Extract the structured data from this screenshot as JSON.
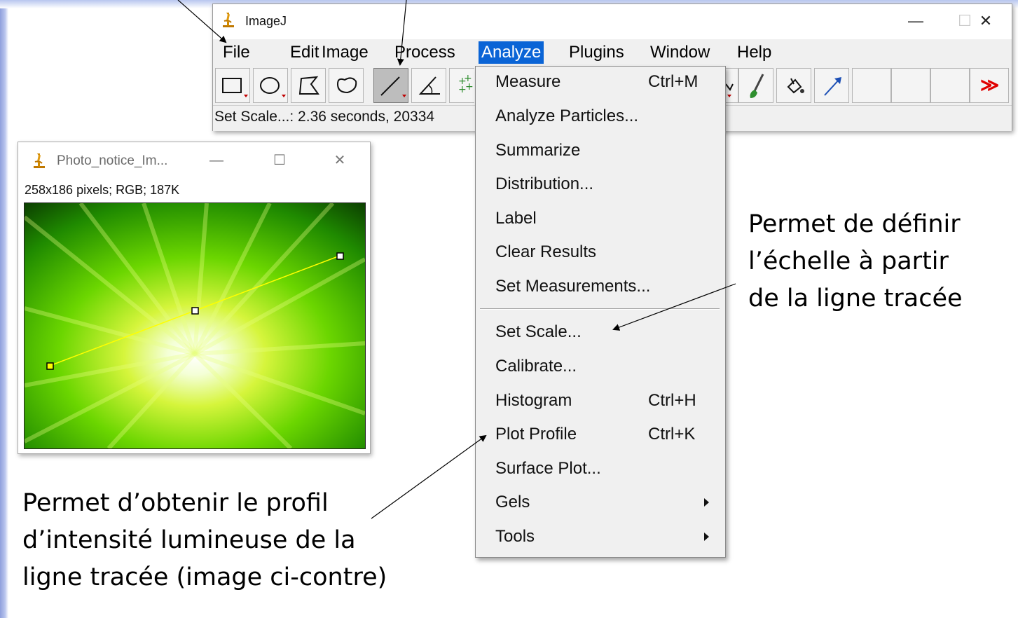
{
  "main_window": {
    "title": "ImageJ",
    "controls": {
      "minimize": "—",
      "maximize": "☐",
      "close": "✕"
    },
    "menus": [
      "File",
      "Edit",
      "Image",
      "Process",
      "Analyze",
      "Plugins",
      "Window",
      "Help"
    ],
    "active_menu": "Analyze",
    "status": "Set Scale...: 2.36 seconds, 20334",
    "tools": [
      "rectangle-icon",
      "oval-icon",
      "polygon-icon",
      "freehand-icon",
      "line-icon",
      "angle-icon",
      "point-icon",
      "dropper-icon",
      "brush-icon",
      "flood-fill-icon",
      "arrow-icon"
    ],
    "more_tools": "≫"
  },
  "image_window": {
    "title": "Photo_notice_Im...",
    "info": "258x186 pixels; RGB; 187K",
    "controls": {
      "minimize": "—",
      "maximize": "☐",
      "close": "✕"
    }
  },
  "analyze_menu": {
    "items": [
      {
        "label": "Measure",
        "shortcut": "Ctrl+M",
        "submenu": false
      },
      {
        "label": "Analyze Particles...",
        "shortcut": "",
        "submenu": false
      },
      {
        "label": "Summarize",
        "shortcut": "",
        "submenu": false
      },
      {
        "label": "Distribution...",
        "shortcut": "",
        "submenu": false
      },
      {
        "label": "Label",
        "shortcut": "",
        "submenu": false
      },
      {
        "label": "Clear Results",
        "shortcut": "",
        "submenu": false
      },
      {
        "label": "Set Measurements...",
        "shortcut": "",
        "submenu": false
      },
      {
        "label": "Set Scale...",
        "shortcut": "",
        "submenu": false
      },
      {
        "label": "Calibrate...",
        "shortcut": "",
        "submenu": false
      },
      {
        "label": "Histogram",
        "shortcut": "Ctrl+H",
        "submenu": false
      },
      {
        "label": "Plot Profile",
        "shortcut": "Ctrl+K",
        "submenu": false
      },
      {
        "label": "Surface Plot...",
        "shortcut": "",
        "submenu": false
      },
      {
        "label": "Gels",
        "shortcut": "",
        "submenu": true
      },
      {
        "label": "Tools",
        "shortcut": "",
        "submenu": true
      }
    ]
  },
  "annotations": {
    "scale_note": [
      "Permet de définir",
      "l’échelle à partir",
      "de la ligne tracée"
    ],
    "profile_note": [
      "Permet d’obtenir le profil",
      "d’intensité lumineuse de la",
      "ligne tracée (image ci-contre)"
    ]
  },
  "colors": {
    "menu_highlight": "#0a64d6",
    "selection_line": "#ffff00",
    "image_green": "#5fd000"
  }
}
